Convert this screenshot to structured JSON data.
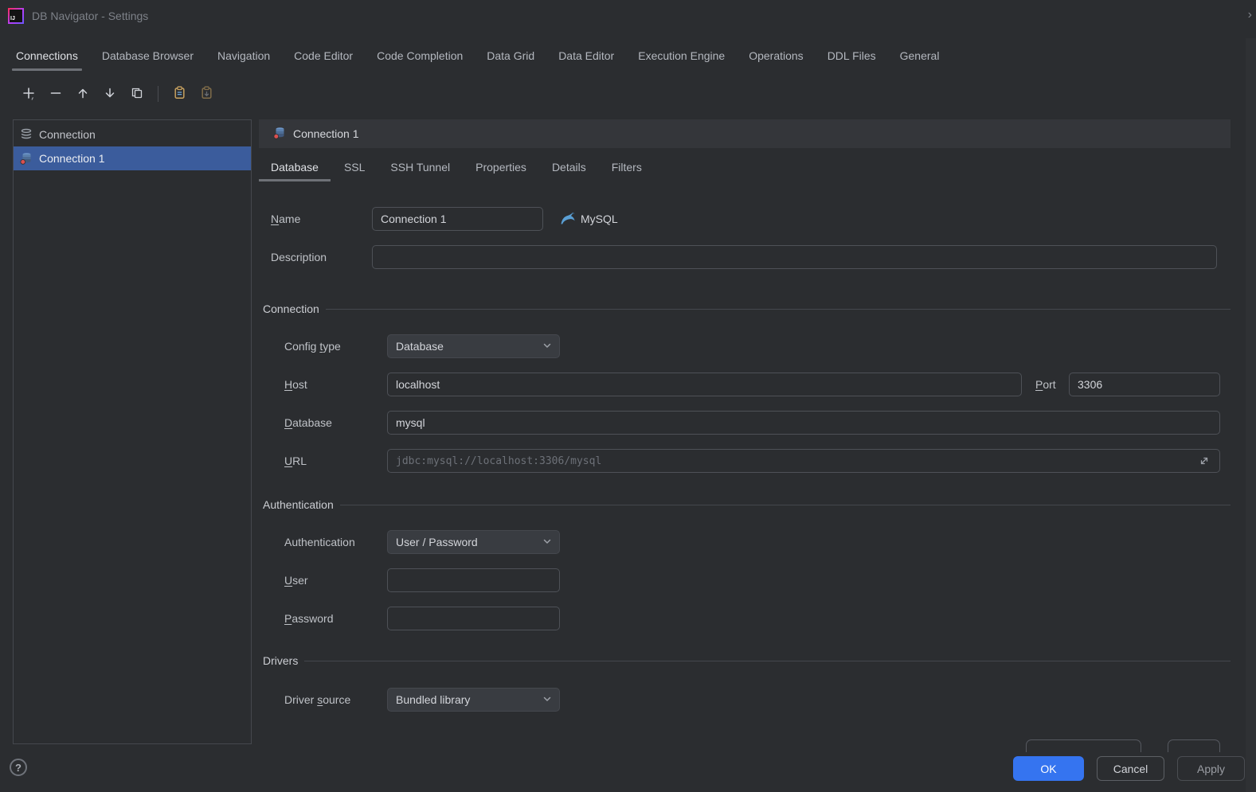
{
  "colors": {
    "accent": "#3574f0",
    "selection": "#3b5c9c",
    "ok_button": "#3574f0"
  },
  "window": {
    "title": "DB Navigator - Settings",
    "logo_text": "IJ",
    "tab_overflow_arrow": "›"
  },
  "main_tabs": {
    "items": [
      "Connections",
      "Database Browser",
      "Navigation",
      "Code Editor",
      "Code Completion",
      "Data Grid",
      "Data Editor",
      "Execution Engine",
      "Operations",
      "DDL Files",
      "General"
    ],
    "active": "Connections"
  },
  "toolbar": {
    "icons": [
      "add-icon",
      "remove-icon",
      "move-up-icon",
      "move-down-icon",
      "duplicate-icon",
      "copy-to-clipboard-icon",
      "paste-from-clipboard-icon"
    ]
  },
  "connection_list": {
    "filter_item": "Connection",
    "items": [
      {
        "label": "Connection 1",
        "selected": true
      }
    ],
    "selected": "Connection 1"
  },
  "detail": {
    "title": "Connection 1",
    "tabs": [
      "Database",
      "SSL",
      "SSH Tunnel",
      "Properties",
      "Details",
      "Filters"
    ],
    "active_tab": "Database",
    "sections": {
      "connection": "Connection",
      "authentication": "Authentication",
      "drivers": "Drivers"
    },
    "fields": {
      "name": {
        "label": {
          "text": "Name",
          "mnemonic": 0
        },
        "value": "Connection 1"
      },
      "database_type": "MySQL",
      "description": {
        "label": {
          "text": "Description",
          "mnemonic": null
        },
        "value": ""
      },
      "config_type": {
        "label": {
          "text": "Config type",
          "mnemonic": 7
        },
        "value": "Database"
      },
      "host": {
        "label": {
          "text": "Host",
          "mnemonic": 0
        },
        "value": "localhost"
      },
      "port": {
        "label": {
          "text": "Port",
          "mnemonic": 0
        },
        "value": "3306"
      },
      "database": {
        "label": {
          "text": "Database",
          "mnemonic": 0
        },
        "value": "mysql"
      },
      "url": {
        "label": {
          "text": "URL",
          "mnemonic": 0
        },
        "value": "jdbc:mysql://localhost:3306/mysql"
      },
      "authentication": {
        "label": {
          "text": "Authentication",
          "mnemonic": null
        },
        "value": "User / Password"
      },
      "user": {
        "label": {
          "text": "User",
          "mnemonic": 0
        },
        "value": ""
      },
      "password": {
        "label": {
          "text": "Password",
          "mnemonic": 0
        },
        "value": ""
      },
      "driver_source": {
        "label": {
          "text": "Driver source",
          "mnemonic": 7
        },
        "value": "Bundled library"
      }
    }
  },
  "footer": {
    "help": "?",
    "ok": "OK",
    "cancel": "Cancel",
    "apply": "Apply"
  }
}
